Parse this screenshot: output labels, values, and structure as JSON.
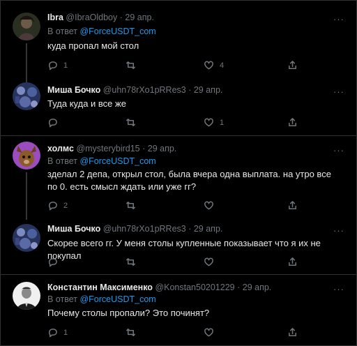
{
  "tweets": [
    {
      "name": "Ibra",
      "handle": "@IbraOldboy",
      "date": "· 29 апр.",
      "reply_prefix": "В ответ",
      "reply_to": "@ForceUSDT_com",
      "text": "куда пропал мой стол",
      "replies": "1",
      "retweets": "",
      "likes": "4",
      "avatar_color": "#3a3f2a"
    },
    {
      "name": "Миша Бочко",
      "handle": "@uhn78rXo1pRRes3",
      "date": "· 29 апр.",
      "text": "Туда куда и все же",
      "replies": "",
      "retweets": "",
      "likes": "1",
      "avatar_color": "#2d3a66"
    },
    {
      "name": "холмс",
      "handle": "@mysterybird15",
      "date": "· 29 апр.",
      "reply_prefix": "В ответ",
      "reply_to": "@ForceUSDT_com",
      "text": "зделал 2 депа, открыл стол, была вчера одна выплата. на утро все по 0. есть смысл ждать или уже гг?",
      "replies": "2",
      "retweets": "",
      "likes": "",
      "avatar_color": "#8e44ad"
    },
    {
      "name": "Миша Бочко",
      "handle": "@uhn78rXo1pRRes3",
      "date": "· 29 апр.",
      "text": "Скорее всего гг. У меня столы купленные показывает что я их не покупал",
      "replies": "",
      "retweets": "",
      "likes": "",
      "avatar_color": "#2d3a66"
    },
    {
      "name": "Константин Максименко",
      "handle": "@Konstan50201229",
      "date": "· 29 апр.",
      "reply_prefix": "В ответ",
      "reply_to": "@ForceUSDT_com",
      "text": "Почему столы пропали? Это починят?",
      "replies": "1",
      "retweets": "",
      "likes": "",
      "avatar_color": "#e8e8e8"
    }
  ],
  "more_label": "···"
}
